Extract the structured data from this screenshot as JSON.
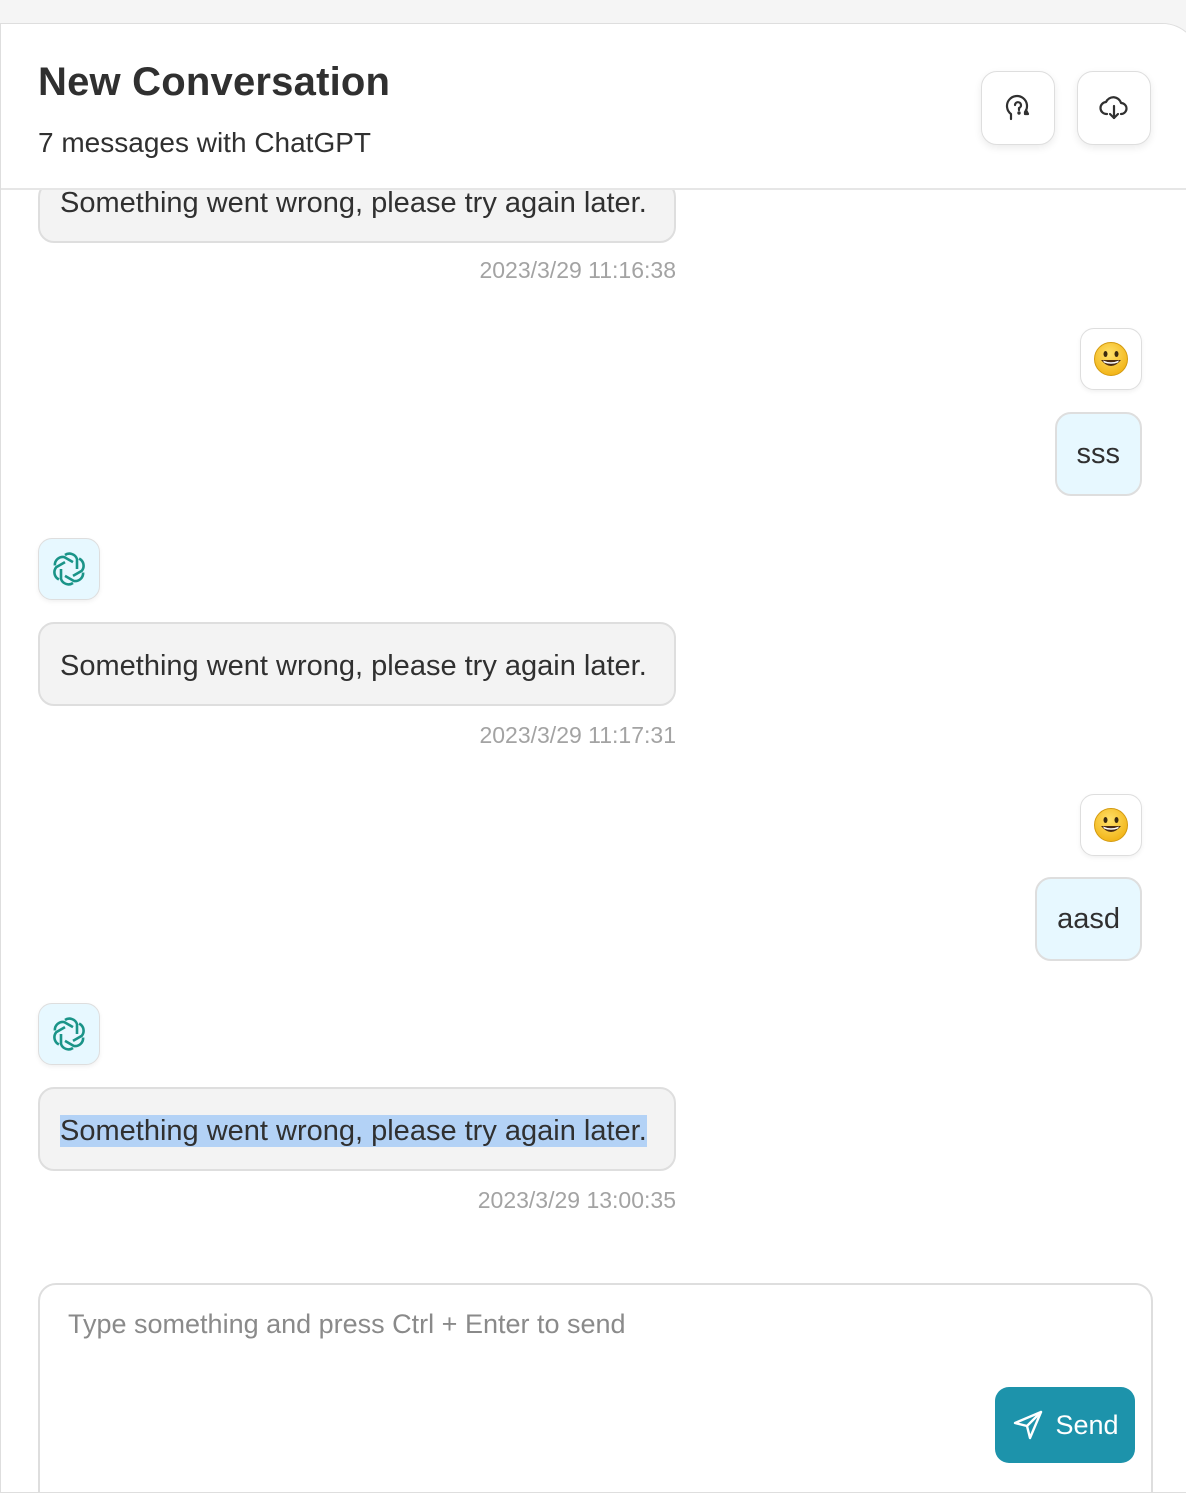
{
  "header": {
    "title": "New Conversation",
    "subtitle": "7 messages with ChatGPT",
    "actions": [
      {
        "name": "brain-icon",
        "tooltip": ""
      },
      {
        "name": "download-icon",
        "tooltip": ""
      }
    ]
  },
  "messages": [
    {
      "role": "assistant",
      "text": "Something went wrong, please try again later.",
      "time": "2023/3/29 11:16:38",
      "partially_visible": true
    },
    {
      "role": "user",
      "text": "sss",
      "avatar": "smiley-emoji"
    },
    {
      "role": "assistant",
      "text": "Something went wrong, please try again later.",
      "time": "2023/3/29 11:17:31",
      "avatar": "openai-logo"
    },
    {
      "role": "user",
      "text": "aasd",
      "avatar": "smiley-emoji"
    },
    {
      "role": "assistant",
      "text": "Something went wrong, please try again later.",
      "time": "2023/3/29 13:00:35",
      "avatar": "openai-logo",
      "selected": true
    }
  ],
  "composer": {
    "placeholder": "Type something and press Ctrl + Enter to send",
    "send_label": "Send"
  },
  "colors": {
    "accent": "#1d93ab",
    "user_bubble": "#e7f8ff",
    "bot_bubble": "#f3f3f3",
    "selection": "#b3d2f6"
  }
}
